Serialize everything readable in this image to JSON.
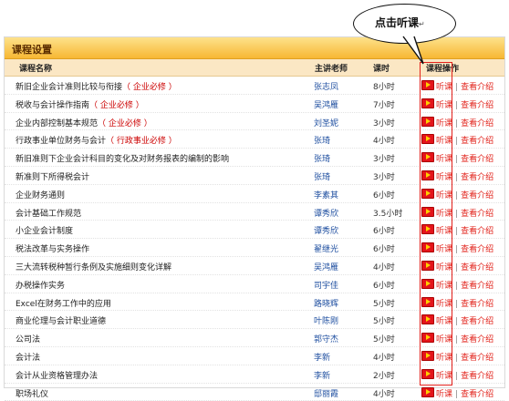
{
  "panel_title": "课程设置",
  "headers": {
    "name": "课程名称",
    "teacher": "主讲老师",
    "hours": "课时",
    "actions": "课程操作"
  },
  "callout": {
    "text": "点击听课",
    "mark": "↵"
  },
  "links": {
    "listen": "听课",
    "separator": "|",
    "view": "查看介绍"
  },
  "courses": [
    {
      "name": "新旧企业会计准则比较与衔接",
      "tag": "（ 企业必修 ）",
      "teacher": "张志凤",
      "hours": "8小时"
    },
    {
      "name": "税收与会计操作指南",
      "tag": "（ 企业必修 ）",
      "teacher": "吴鸿雁",
      "hours": "7小时"
    },
    {
      "name": "企业内部控制基本规范",
      "tag": "（ 企业必修 ）",
      "teacher": "刘圣妮",
      "hours": "3小时"
    },
    {
      "name": "行政事业单位财务与会计",
      "tag": "（ 行政事业必修 ）",
      "teacher": "张琦",
      "hours": "4小时"
    },
    {
      "name": "新旧准则下企业会计科目的变化及对财务报表的编制的影响",
      "tag": "",
      "teacher": "张琦",
      "hours": "3小时"
    },
    {
      "name": "新准则下所得税会计",
      "tag": "",
      "teacher": "张琦",
      "hours": "3小时"
    },
    {
      "name": "企业财务通则",
      "tag": "",
      "teacher": "李素其",
      "hours": "6小时"
    },
    {
      "name": "会计基础工作规范",
      "tag": "",
      "teacher": "谭秀欣",
      "hours": "3.5小时"
    },
    {
      "name": "小企业会计制度",
      "tag": "",
      "teacher": "谭秀欣",
      "hours": "6小时"
    },
    {
      "name": "税法改革与实务操作",
      "tag": "",
      "teacher": "翟继光",
      "hours": "6小时"
    },
    {
      "name": "三大流转税种暂行条例及实施细则变化详解",
      "tag": "",
      "teacher": "吴鸿雁",
      "hours": "4小时"
    },
    {
      "name": "办税操作实务",
      "tag": "",
      "teacher": "司宇佳",
      "hours": "6小时"
    },
    {
      "name": "Excel在财务工作中的应用",
      "tag": "",
      "teacher": "路晓辉",
      "hours": "5小时"
    },
    {
      "name": "商业伦理与会计职业道德",
      "tag": "",
      "teacher": "叶陈刚",
      "hours": "5小时"
    },
    {
      "name": "公司法",
      "tag": "",
      "teacher": "郭守杰",
      "hours": "5小时"
    },
    {
      "name": "会计法",
      "tag": "",
      "teacher": "李新",
      "hours": "4小时"
    },
    {
      "name": "会计从业资格管理办法",
      "tag": "",
      "teacher": "李新",
      "hours": "2小时"
    },
    {
      "name": "职场礼仪",
      "tag": "",
      "teacher": "邸丽霞",
      "hours": "4小时"
    }
  ],
  "colors": {
    "title_bar": "#f7b733",
    "header_row": "#fbe7c4",
    "link": "#e2241c",
    "teacher": "#1f4fa0",
    "highlight": "#e3201b"
  }
}
